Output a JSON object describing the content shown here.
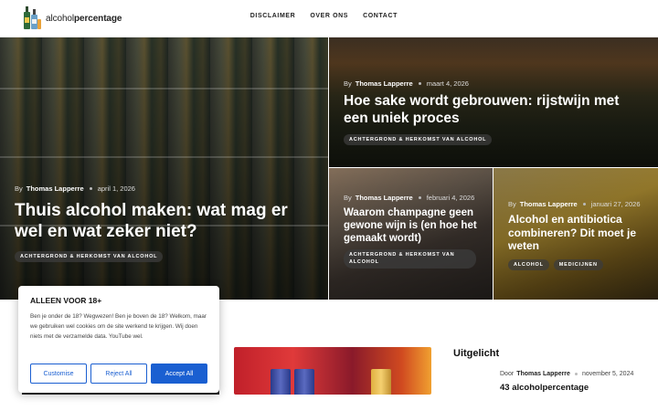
{
  "header": {
    "logo_text_light": "alcohol",
    "logo_text_bold": "percentage",
    "nav": [
      "DISCLAIMER",
      "OVER ONS",
      "CONTACT"
    ]
  },
  "hero": [
    {
      "author_prefix": "By",
      "author": "Thomas Lapperre",
      "date": "april 1, 2026",
      "title": "Thuis alcohol maken: wat mag er wel en wat zeker niet?",
      "tags": [
        "ACHTERGROND & HERKOMST VAN ALCOHOL"
      ]
    },
    {
      "author_prefix": "By",
      "author": "Thomas Lapperre",
      "date": "maart 4, 2026",
      "title": "Hoe sake wordt gebrouwen: rijstwijn met een uniek proces",
      "tags": [
        "ACHTERGROND & HERKOMST VAN ALCOHOL"
      ]
    },
    {
      "author_prefix": "By",
      "author": "Thomas Lapperre",
      "date": "februari 4, 2026",
      "title": "Waarom champagne geen gewone wijn is (en hoe het gemaakt wordt)",
      "tags": [
        "ACHTERGROND & HERKOMST VAN ALCOHOL"
      ]
    },
    {
      "author_prefix": "By",
      "author": "Thomas Lapperre",
      "date": "januari 27, 2026",
      "title": "Alcohol en antibiotica combineren? Dit moet je weten",
      "tags": [
        "ALCOHOL",
        "MEDICIJNEN"
      ]
    }
  ],
  "featured": {
    "heading": "Uitgelicht",
    "author_prefix": "Door",
    "author": "Thomas Lapperre",
    "date": "november 5, 2024",
    "title": "43 alcoholpercentage"
  },
  "cookie": {
    "title": "ALLEEN VOOR 18+",
    "text": "Ben je onder de 18? Wegwezen! Ben je boven de 18? Welkom, maar we gebruiken wel cookies om de site werkend te krijgen. Wij doen niets met de verzamelde data. YouTube wel.",
    "customise": "Customise",
    "reject": "Reject All",
    "accept": "Accept All"
  },
  "colors": {
    "accent": "#1a5fd1"
  }
}
